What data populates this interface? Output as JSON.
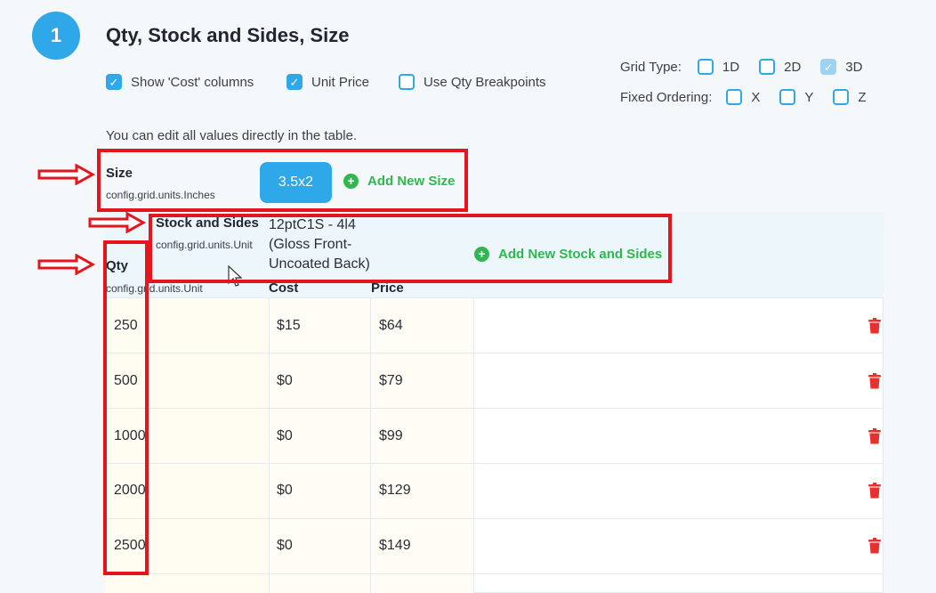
{
  "step": {
    "number": "1",
    "title": "Qty, Stock and Sides, Size"
  },
  "options": {
    "show_cost": {
      "label": "Show 'Cost' columns",
      "checked": true
    },
    "unit_price": {
      "label": "Unit Price",
      "checked": true
    },
    "qty_breakpoints": {
      "label": "Use Qty Breakpoints",
      "checked": false
    }
  },
  "grid_type": {
    "label": "Grid Type:",
    "options": [
      {
        "label": "1D",
        "checked": false
      },
      {
        "label": "2D",
        "checked": false
      },
      {
        "label": "3D",
        "checked": true
      }
    ]
  },
  "fixed_ordering": {
    "label": "Fixed Ordering:",
    "options": [
      {
        "label": "X",
        "checked": false
      },
      {
        "label": "Y",
        "checked": false
      },
      {
        "label": "Z",
        "checked": false
      }
    ]
  },
  "hint": "You can edit all values directly in the table.",
  "size": {
    "label": "Size",
    "unit": "config.grid.units.Inches",
    "value": "3.5x2",
    "add_label": "Add New Size"
  },
  "stock": {
    "label": "Stock and Sides",
    "unit": "config.grid.units.Unit",
    "value_line1": "12ptC1S - 4l4",
    "value_line2": "(Gloss Front-",
    "value_line3": "Uncoated Back)",
    "add_label": "Add New Stock and Sides"
  },
  "qty": {
    "label": "Qty",
    "unit": "config.grid.units.Unit"
  },
  "columns": {
    "cost": "Cost",
    "price": "Price"
  },
  "rows": [
    {
      "qty": "250",
      "cost": "$15",
      "price": "$64"
    },
    {
      "qty": "500",
      "cost": "$0",
      "price": "$79"
    },
    {
      "qty": "1000",
      "cost": "$0",
      "price": "$99"
    },
    {
      "qty": "2000",
      "cost": "$0",
      "price": "$129"
    },
    {
      "qty": "2500",
      "cost": "$0",
      "price": "$149"
    }
  ],
  "colors": {
    "accent": "#2ea8e8",
    "add": "#2fb84f",
    "delete": "#e8312f",
    "annotation": "#e4151c"
  }
}
